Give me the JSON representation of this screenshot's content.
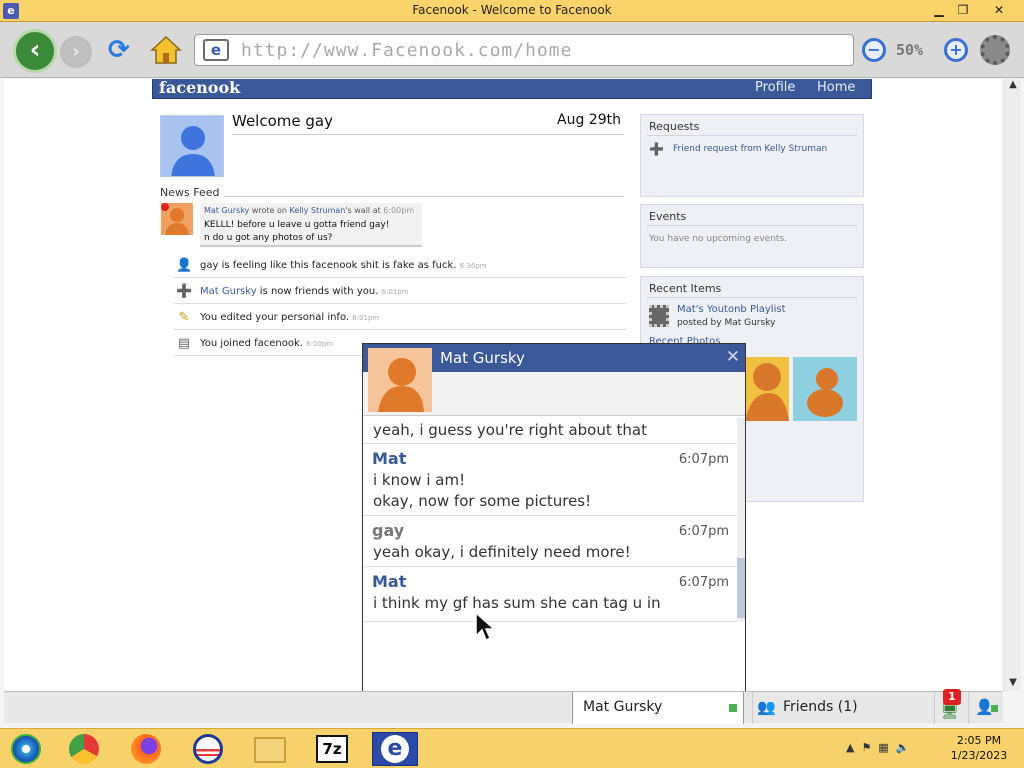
{
  "window": {
    "title": "Facenook - Welcome to Facenook",
    "minimize": "▁",
    "maximize": "❐",
    "close": "✕"
  },
  "toolbar": {
    "url": "http://www.Facenook.com/home",
    "zoom": "50%",
    "zoom_out": "−",
    "zoom_in": "+"
  },
  "site": {
    "logo": "facenook",
    "nav": [
      "Profile",
      "Home"
    ]
  },
  "profile": {
    "welcome": "Welcome gay",
    "date": "Aug 29th",
    "news_feed_label": "News Feed"
  },
  "wall_post": {
    "author": "Mat Gursky",
    "mid1": " wrote on ",
    "target": "Kelly Struman",
    "mid2": "'s wall at ",
    "time": "6:00pm",
    "line1": "KELLL! before u leave u gotta friend gay!",
    "line2": "n do u got any photos of us?"
  },
  "feed": [
    {
      "icon": "person-icon",
      "glyph": "👤",
      "text": "gay is feeling like this facenook shit is fake as fuck.",
      "time": "6:36pm",
      "link": ""
    },
    {
      "icon": "add-friend-icon",
      "glyph": "➕",
      "link": "Mat Gursky",
      "text": " is now friends with you.",
      "time": "6:01pm"
    },
    {
      "icon": "pencil-icon",
      "glyph": "✎",
      "text": "You edited your personal info.",
      "time": "6:01pm",
      "link": ""
    },
    {
      "icon": "profile-card-icon",
      "glyph": "▤",
      "text": "You joined facenook.",
      "time": "6:00pm",
      "link": ""
    }
  ],
  "sidebar": {
    "requests": {
      "title": "Requests",
      "item": "Friend request from Kelly Struman"
    },
    "events": {
      "title": "Events",
      "empty": "You have no upcoming events."
    },
    "recent": {
      "title": "Recent Items",
      "playlist": "Mat's Youtonb Playlist",
      "posted_by": "posted by Mat Gursky",
      "photos_title": "Recent Photos"
    }
  },
  "chat": {
    "name": "Mat Gursky",
    "close": "✕",
    "partial": "yeah, i guess you're right about that",
    "messages": [
      {
        "who": "Mat",
        "time": "6:07pm",
        "lines": [
          "i know i am!",
          "okay, now for some pictures!"
        ]
      },
      {
        "who": "gay",
        "time": "6:07pm",
        "lines": [
          "yeah okay, i definitely need more!"
        ]
      },
      {
        "who": "Mat",
        "time": "6:07pm",
        "lines": [
          "i think my gf has sum she can tag u in"
        ]
      }
    ]
  },
  "chatbar": {
    "tab": "Mat Gursky",
    "friends": "Friends (1)",
    "notifications": "1"
  },
  "taskbar": {
    "time": "2:05 PM",
    "date": "1/23/2023",
    "apps": [
      "media-center-icon",
      "chrome-icon",
      "firefox-icon",
      "obama-icon",
      "folder-icon",
      "7zip-icon",
      "browser-e-icon"
    ]
  },
  "colors": {
    "facebook_blue": "#3b5998",
    "title_bar": "#fad36b",
    "taskbar": "#f7d26a",
    "frame": "#1f1fb5"
  }
}
